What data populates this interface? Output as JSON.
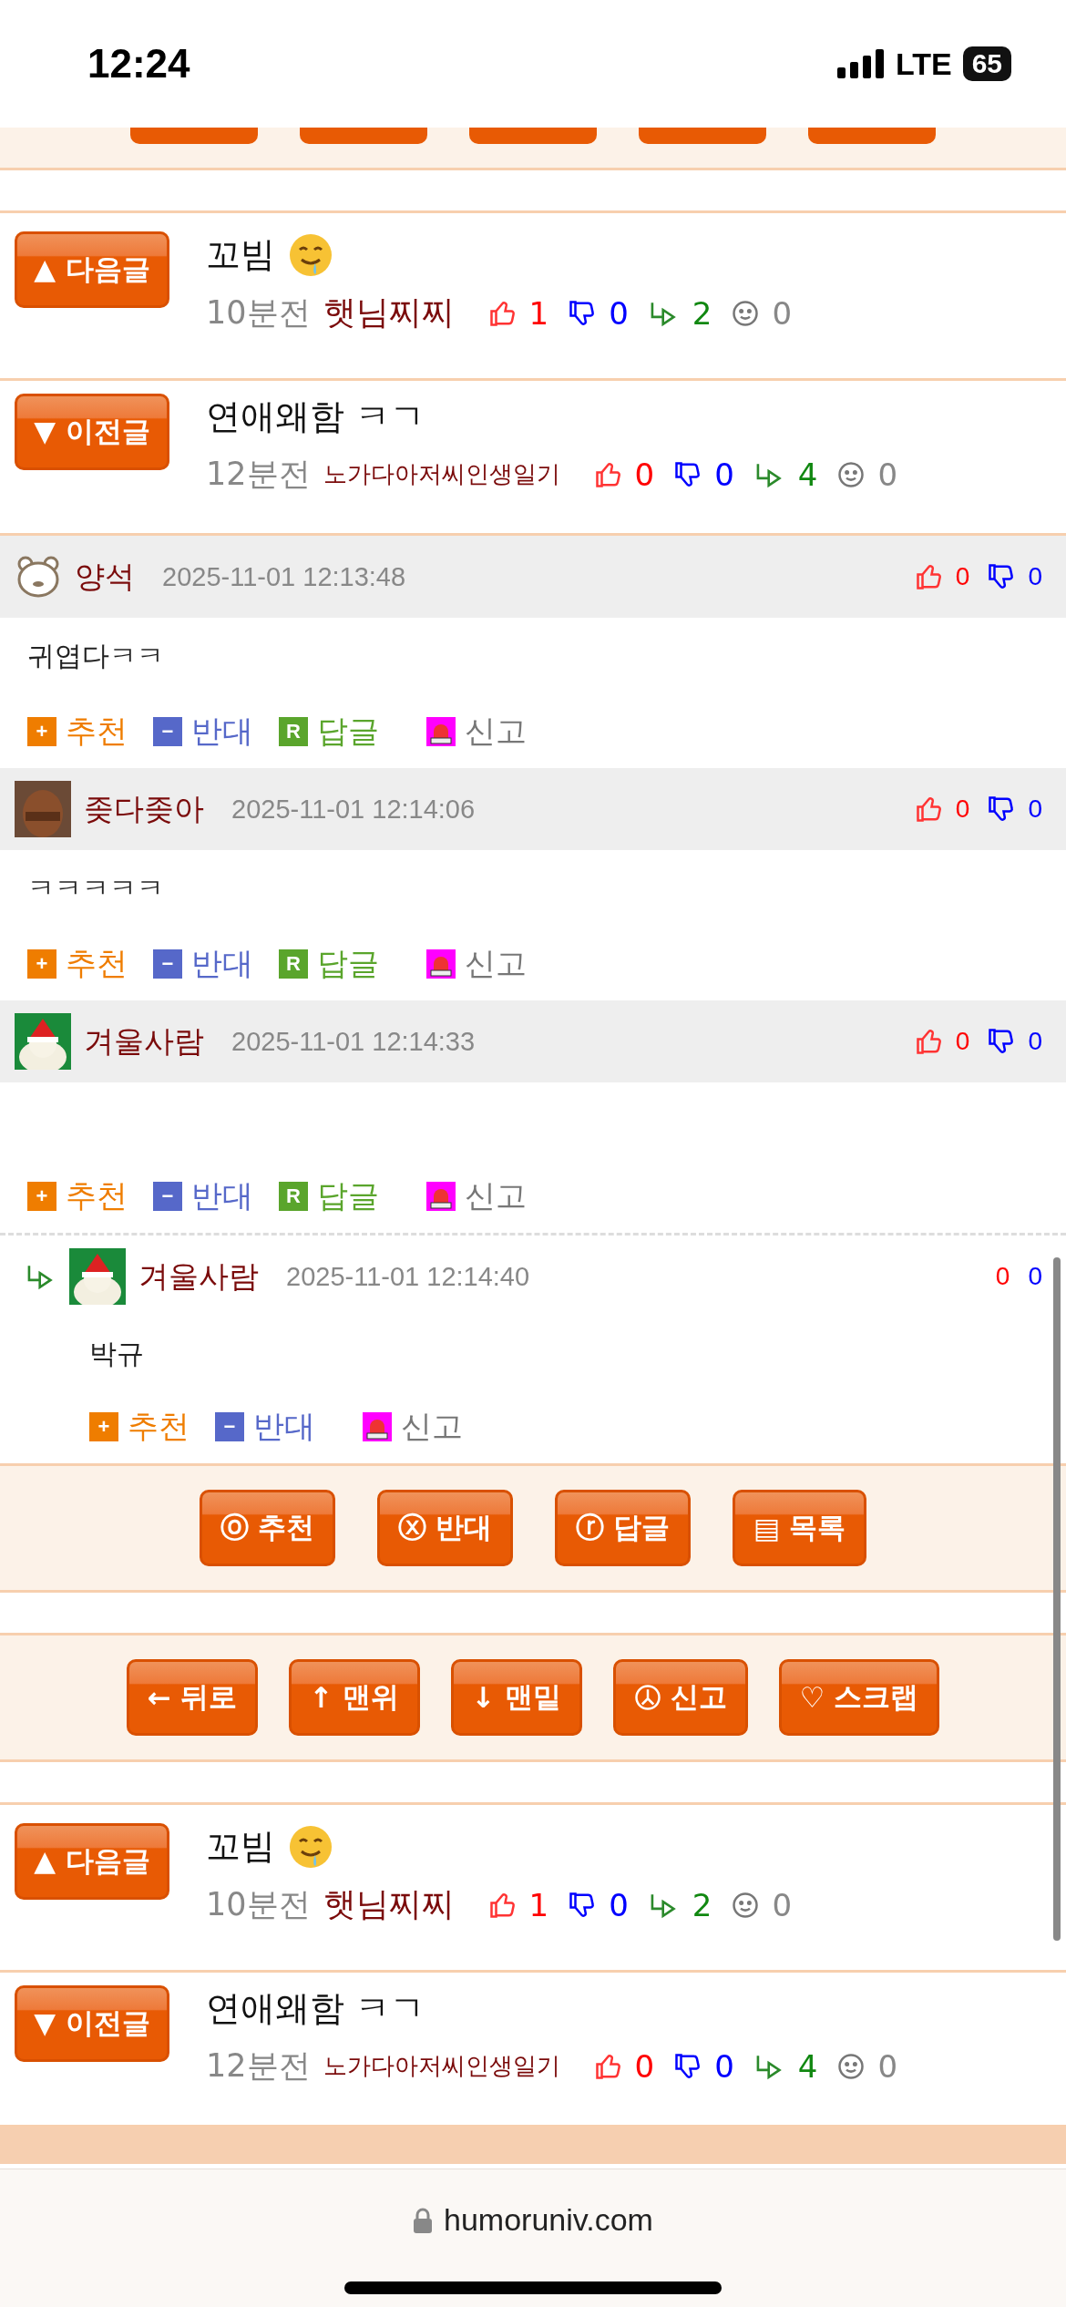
{
  "status_bar": {
    "time": "12:24",
    "network": "LTE",
    "battery": "65"
  },
  "post_links_top": [
    {
      "button": "▲ 다음글",
      "title": "꼬빔",
      "emoji": true,
      "age": "10분전",
      "author": "햇님찌찌",
      "author_small": false,
      "likes": "1",
      "dislikes": "0",
      "replies": "2",
      "views": "0"
    },
    {
      "button": "▼ 이전글",
      "title": "연애왜함 ㅋㄱ",
      "emoji": false,
      "age": "12분전",
      "author": "노가다아저씨인생일기",
      "author_small": true,
      "likes": "0",
      "dislikes": "0",
      "replies": "4",
      "views": "0"
    }
  ],
  "comments": [
    {
      "kind": "comment",
      "author": "양석",
      "time": "2025-11-01 12:13:48",
      "likes": "0",
      "dislikes": "0",
      "body": "귀엽다ㅋㅋ",
      "actions": [
        {
          "kind": "recommend",
          "badge": "+",
          "label": "추천"
        },
        {
          "kind": "oppose",
          "badge": "−",
          "label": "반대"
        },
        {
          "kind": "reply",
          "badge": "R",
          "label": "답글"
        },
        {
          "kind": "report",
          "label": "신고"
        }
      ]
    },
    {
      "kind": "comment",
      "author": "좆다좆아",
      "time": "2025-11-01 12:14:06",
      "likes": "0",
      "dislikes": "0",
      "body": "ㅋㅋㅋㅋㅋ",
      "actions": [
        {
          "kind": "recommend",
          "badge": "+",
          "label": "추천"
        },
        {
          "kind": "oppose",
          "badge": "−",
          "label": "반대"
        },
        {
          "kind": "reply",
          "badge": "R",
          "label": "답글"
        },
        {
          "kind": "report",
          "label": "신고"
        }
      ]
    },
    {
      "kind": "comment",
      "author": "겨울사람",
      "time": "2025-11-01 12:14:33",
      "likes": "0",
      "dislikes": "0",
      "actions": [
        {
          "kind": "recommend",
          "badge": "+",
          "label": "추천"
        },
        {
          "kind": "oppose",
          "badge": "−",
          "label": "반대"
        },
        {
          "kind": "reply",
          "badge": "R",
          "label": "답글"
        },
        {
          "kind": "report",
          "label": "신고"
        }
      ]
    },
    {
      "kind": "reply",
      "author": "겨울사람",
      "time": "2025-11-01 12:14:40",
      "likes": "0",
      "dislikes": "0",
      "body": "박규",
      "actions": [
        {
          "kind": "recommend",
          "badge": "+",
          "label": "추천"
        },
        {
          "kind": "oppose",
          "badge": "−",
          "label": "반대"
        },
        {
          "kind": "report",
          "label": "신고"
        }
      ]
    }
  ],
  "comment_buttons": [
    {
      "glyph": "ⓞ",
      "label": "추천"
    },
    {
      "glyph": "ⓧ",
      "label": "반대"
    },
    {
      "glyph": "ⓡ",
      "label": "답글"
    },
    {
      "glyph": "▤",
      "label": "목록"
    }
  ],
  "nav_buttons": [
    {
      "glyph": "←",
      "label": "뒤로"
    },
    {
      "glyph": "↑",
      "label": "맨위"
    },
    {
      "glyph": "↓",
      "label": "맨밑"
    },
    {
      "kind": "report",
      "label": "신고"
    },
    {
      "glyph": "♡",
      "label": "스크랩"
    }
  ],
  "post_links_bottom": [
    {
      "button": "▲ 다음글",
      "title": "꼬빔",
      "emoji": true,
      "age": "10분전",
      "author": "햇님찌찌",
      "author_small": false,
      "likes": "1",
      "dislikes": "0",
      "replies": "2",
      "views": "0"
    },
    {
      "button": "▼ 이전글",
      "title": "연애왜함 ㅋㄱ",
      "emoji": false,
      "age": "12분전",
      "author": "노가다아저씨인생일기",
      "author_small": true,
      "likes": "0",
      "dislikes": "0",
      "replies": "4",
      "views": "0"
    }
  ],
  "browser": {
    "url": "humoruniv.com"
  }
}
